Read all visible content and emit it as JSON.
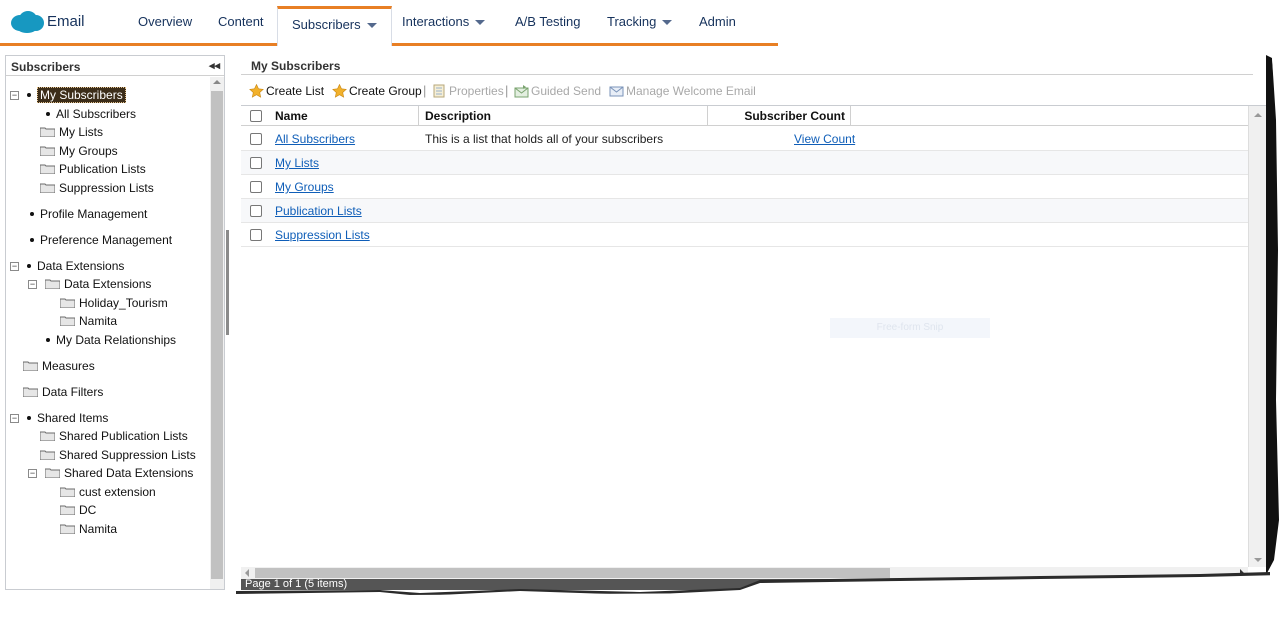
{
  "nav": {
    "app_name": "Email",
    "tabs": [
      {
        "label": "Overview"
      },
      {
        "label": "Content"
      },
      {
        "label": "Subscribers"
      },
      {
        "label": "Interactions"
      },
      {
        "label": "A/B Testing"
      },
      {
        "label": "Tracking"
      },
      {
        "label": "Admin"
      }
    ],
    "active_tab": "Subscribers",
    "accent_color": "#e87f24",
    "logo_color": "#1798c1"
  },
  "left_panel": {
    "title": "Subscribers",
    "collapse_glyph": "◂◂",
    "tree": [
      {
        "label": "My Subscribers",
        "selected": true
      },
      {
        "label": "All Subscribers"
      },
      {
        "label": "My Lists"
      },
      {
        "label": "My Groups"
      },
      {
        "label": "Publication Lists"
      },
      {
        "label": "Suppression Lists"
      },
      {
        "label": "Profile Management"
      },
      {
        "label": "Preference Management"
      },
      {
        "label": "Data Extensions"
      },
      {
        "label": "Data Extensions"
      },
      {
        "label": "Holiday_Tourism"
      },
      {
        "label": "Namita"
      },
      {
        "label": "My Data Relationships"
      },
      {
        "label": "Measures"
      },
      {
        "label": "Data Filters"
      },
      {
        "label": "Shared Items"
      },
      {
        "label": "Shared Publication Lists"
      },
      {
        "label": "Shared Suppression Lists"
      },
      {
        "label": "Shared Data Extensions"
      },
      {
        "label": "cust extension"
      },
      {
        "label": "DC"
      },
      {
        "label": "Namita"
      }
    ]
  },
  "main": {
    "title": "My Subscribers",
    "toolbar": {
      "create_list": "Create List",
      "create_group": "Create Group",
      "properties": "Properties",
      "guided_send": "Guided Send",
      "manage_welcome": "Manage Welcome Email",
      "separator": "|"
    },
    "columns": {
      "name": "Name",
      "description": "Description",
      "count": "Subscriber Count"
    },
    "rows": [
      {
        "name": "All Subscribers",
        "description": "This is a list that holds all of your subscribers",
        "count": "View Count"
      },
      {
        "name": "My Lists",
        "description": "",
        "count": ""
      },
      {
        "name": "My Groups",
        "description": "",
        "count": ""
      },
      {
        "name": "Publication Lists",
        "description": "",
        "count": ""
      },
      {
        "name": "Suppression Lists",
        "description": "",
        "count": ""
      }
    ],
    "pager": "Page 1 of 1 (5 items)",
    "ghost_overlay": "Free-form Snip"
  }
}
